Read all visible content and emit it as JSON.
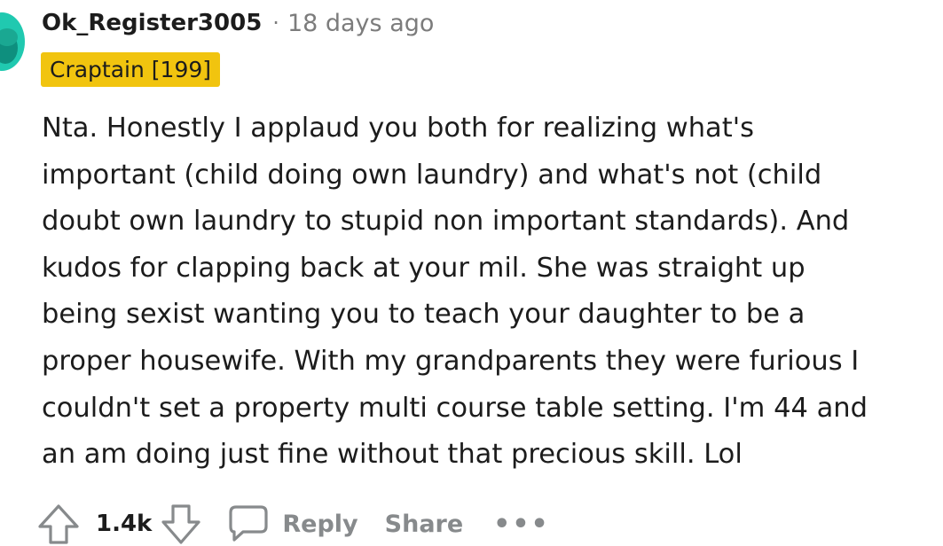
{
  "comment": {
    "username": "Ok_Register3005",
    "separator": "·",
    "timestamp": "18 days ago",
    "flair": "Craptain [199]",
    "lines": [
      "Nta.  Honestly I applaud you both for realizing what's",
      "important (child doing own laundry) and what's not (child",
      "doubt own laundry to stupid non important standards).  And",
      "kudos for clapping back at your mil.  She was straight up",
      "being sexist wanting you to teach your daughter to be a",
      "proper housewife.  With my grandparents they were furious I",
      "couldn't set a property multi course table setting.  I'm 44 and",
      "an am doing just fine without that precious skill.  Lol"
    ]
  },
  "actions": {
    "score": "1.4k",
    "reply_label": "Reply",
    "share_label": "Share",
    "more_label": "•••",
    "upvote_icon": "upvote-arrow-icon",
    "downvote_icon": "downvote-arrow-icon",
    "reply_icon": "speech-bubble-icon"
  },
  "colors": {
    "flair_bg": "#f1c40f",
    "avatar_bg": "#20c9b0",
    "muted_text": "#7c7c7c",
    "action_gray": "#878a8c"
  }
}
